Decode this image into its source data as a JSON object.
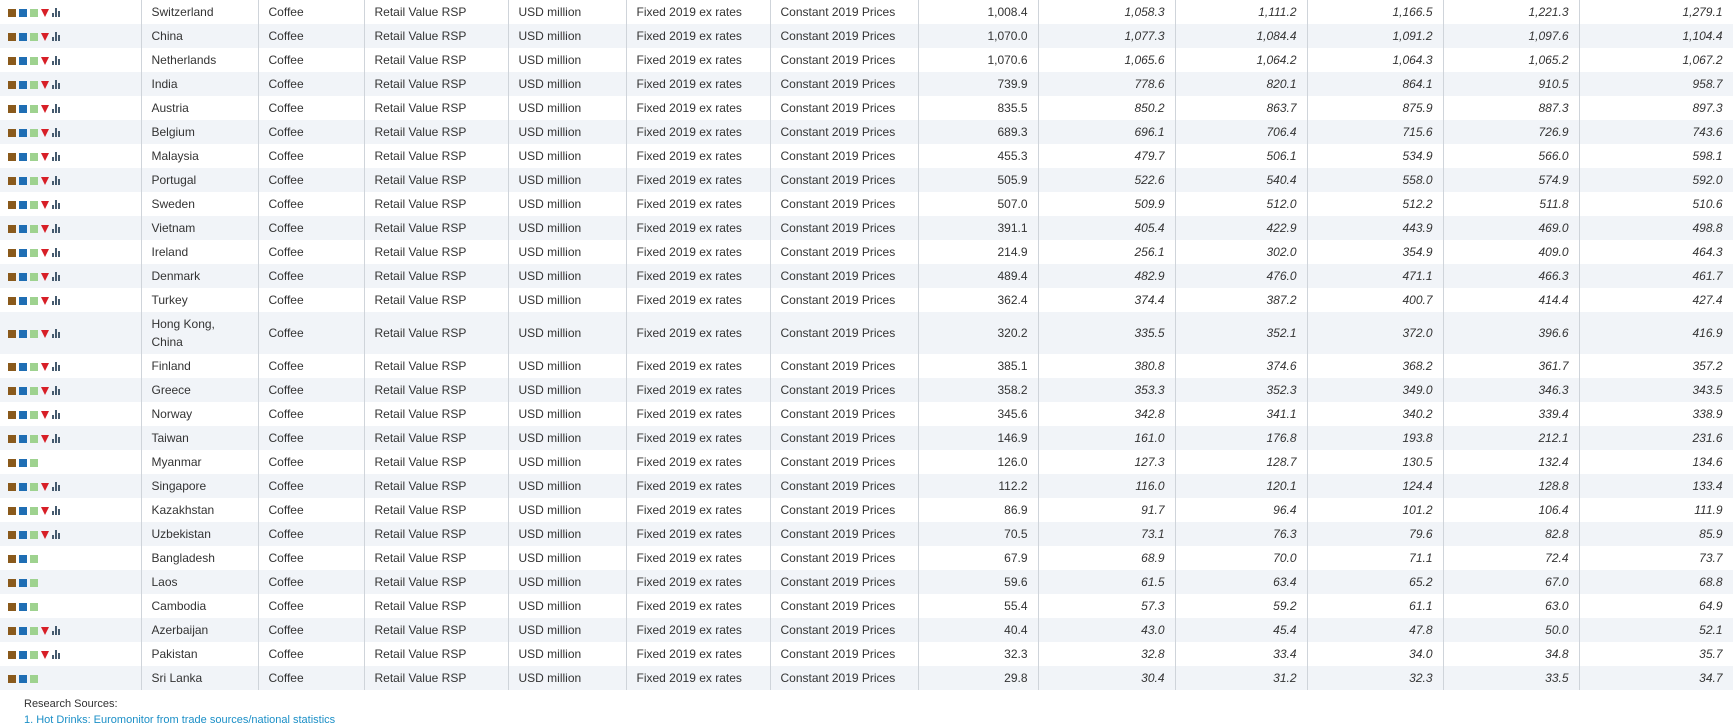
{
  "table": {
    "rows": [
      {
        "geography": "Switzerland",
        "category": "Coffee",
        "data_type": "Retail Value RSP",
        "unit": "USD million",
        "currency": "Fixed 2019 ex rates",
        "price_basis": "Constant 2019 Prices",
        "v2019": "1,008.4",
        "v2020": "1,058.3",
        "v2021": "1,111.2",
        "v2022": "1,166.5",
        "v2023": "1,221.3",
        "v2024": "1,279.1",
        "icons": "full"
      },
      {
        "geography": "China",
        "category": "Coffee",
        "data_type": "Retail Value RSP",
        "unit": "USD million",
        "currency": "Fixed 2019 ex rates",
        "price_basis": "Constant 2019 Prices",
        "v2019": "1,070.0",
        "v2020": "1,077.3",
        "v2021": "1,084.4",
        "v2022": "1,091.2",
        "v2023": "1,097.6",
        "v2024": "1,104.4",
        "icons": "full"
      },
      {
        "geography": "Netherlands",
        "category": "Coffee",
        "data_type": "Retail Value RSP",
        "unit": "USD million",
        "currency": "Fixed 2019 ex rates",
        "price_basis": "Constant 2019 Prices",
        "v2019": "1,070.6",
        "v2020": "1,065.6",
        "v2021": "1,064.2",
        "v2022": "1,064.3",
        "v2023": "1,065.2",
        "v2024": "1,067.2",
        "icons": "full"
      },
      {
        "geography": "India",
        "category": "Coffee",
        "data_type": "Retail Value RSP",
        "unit": "USD million",
        "currency": "Fixed 2019 ex rates",
        "price_basis": "Constant 2019 Prices",
        "v2019": "739.9",
        "v2020": "778.6",
        "v2021": "820.1",
        "v2022": "864.1",
        "v2023": "910.5",
        "v2024": "958.7",
        "icons": "full"
      },
      {
        "geography": "Austria",
        "category": "Coffee",
        "data_type": "Retail Value RSP",
        "unit": "USD million",
        "currency": "Fixed 2019 ex rates",
        "price_basis": "Constant 2019 Prices",
        "v2019": "835.5",
        "v2020": "850.2",
        "v2021": "863.7",
        "v2022": "875.9",
        "v2023": "887.3",
        "v2024": "897.3",
        "icons": "full"
      },
      {
        "geography": "Belgium",
        "category": "Coffee",
        "data_type": "Retail Value RSP",
        "unit": "USD million",
        "currency": "Fixed 2019 ex rates",
        "price_basis": "Constant 2019 Prices",
        "v2019": "689.3",
        "v2020": "696.1",
        "v2021": "706.4",
        "v2022": "715.6",
        "v2023": "726.9",
        "v2024": "743.6",
        "icons": "full"
      },
      {
        "geography": "Malaysia",
        "category": "Coffee",
        "data_type": "Retail Value RSP",
        "unit": "USD million",
        "currency": "Fixed 2019 ex rates",
        "price_basis": "Constant 2019 Prices",
        "v2019": "455.3",
        "v2020": "479.7",
        "v2021": "506.1",
        "v2022": "534.9",
        "v2023": "566.0",
        "v2024": "598.1",
        "icons": "full"
      },
      {
        "geography": "Portugal",
        "category": "Coffee",
        "data_type": "Retail Value RSP",
        "unit": "USD million",
        "currency": "Fixed 2019 ex rates",
        "price_basis": "Constant 2019 Prices",
        "v2019": "505.9",
        "v2020": "522.6",
        "v2021": "540.4",
        "v2022": "558.0",
        "v2023": "574.9",
        "v2024": "592.0",
        "icons": "full"
      },
      {
        "geography": "Sweden",
        "category": "Coffee",
        "data_type": "Retail Value RSP",
        "unit": "USD million",
        "currency": "Fixed 2019 ex rates",
        "price_basis": "Constant 2019 Prices",
        "v2019": "507.0",
        "v2020": "509.9",
        "v2021": "512.0",
        "v2022": "512.2",
        "v2023": "511.8",
        "v2024": "510.6",
        "icons": "full"
      },
      {
        "geography": "Vietnam",
        "category": "Coffee",
        "data_type": "Retail Value RSP",
        "unit": "USD million",
        "currency": "Fixed 2019 ex rates",
        "price_basis": "Constant 2019 Prices",
        "v2019": "391.1",
        "v2020": "405.4",
        "v2021": "422.9",
        "v2022": "443.9",
        "v2023": "469.0",
        "v2024": "498.8",
        "icons": "full"
      },
      {
        "geography": "Ireland",
        "category": "Coffee",
        "data_type": "Retail Value RSP",
        "unit": "USD million",
        "currency": "Fixed 2019 ex rates",
        "price_basis": "Constant 2019 Prices",
        "v2019": "214.9",
        "v2020": "256.1",
        "v2021": "302.0",
        "v2022": "354.9",
        "v2023": "409.0",
        "v2024": "464.3",
        "icons": "full"
      },
      {
        "geography": "Denmark",
        "category": "Coffee",
        "data_type": "Retail Value RSP",
        "unit": "USD million",
        "currency": "Fixed 2019 ex rates",
        "price_basis": "Constant 2019 Prices",
        "v2019": "489.4",
        "v2020": "482.9",
        "v2021": "476.0",
        "v2022": "471.1",
        "v2023": "466.3",
        "v2024": "461.7",
        "icons": "full"
      },
      {
        "geography": "Turkey",
        "category": "Coffee",
        "data_type": "Retail Value RSP",
        "unit": "USD million",
        "currency": "Fixed 2019 ex rates",
        "price_basis": "Constant 2019 Prices",
        "v2019": "362.4",
        "v2020": "374.4",
        "v2021": "387.2",
        "v2022": "400.7",
        "v2023": "414.4",
        "v2024": "427.4",
        "icons": "full"
      },
      {
        "geography": "Hong Kong, China",
        "category": "Coffee",
        "data_type": "Retail Value RSP",
        "unit": "USD million",
        "currency": "Fixed 2019 ex rates",
        "price_basis": "Constant 2019 Prices",
        "v2019": "320.2",
        "v2020": "335.5",
        "v2021": "352.1",
        "v2022": "372.0",
        "v2023": "396.6",
        "v2024": "416.9",
        "icons": "full",
        "tall": true
      },
      {
        "geography": "Finland",
        "category": "Coffee",
        "data_type": "Retail Value RSP",
        "unit": "USD million",
        "currency": "Fixed 2019 ex rates",
        "price_basis": "Constant 2019 Prices",
        "v2019": "385.1",
        "v2020": "380.8",
        "v2021": "374.6",
        "v2022": "368.2",
        "v2023": "361.7",
        "v2024": "357.2",
        "icons": "full"
      },
      {
        "geography": "Greece",
        "category": "Coffee",
        "data_type": "Retail Value RSP",
        "unit": "USD million",
        "currency": "Fixed 2019 ex rates",
        "price_basis": "Constant 2019 Prices",
        "v2019": "358.2",
        "v2020": "353.3",
        "v2021": "352.3",
        "v2022": "349.0",
        "v2023": "346.3",
        "v2024": "343.5",
        "icons": "full"
      },
      {
        "geography": "Norway",
        "category": "Coffee",
        "data_type": "Retail Value RSP",
        "unit": "USD million",
        "currency": "Fixed 2019 ex rates",
        "price_basis": "Constant 2019 Prices",
        "v2019": "345.6",
        "v2020": "342.8",
        "v2021": "341.1",
        "v2022": "340.2",
        "v2023": "339.4",
        "v2024": "338.9",
        "icons": "full"
      },
      {
        "geography": "Taiwan",
        "category": "Coffee",
        "data_type": "Retail Value RSP",
        "unit": "USD million",
        "currency": "Fixed 2019 ex rates",
        "price_basis": "Constant 2019 Prices",
        "v2019": "146.9",
        "v2020": "161.0",
        "v2021": "176.8",
        "v2022": "193.8",
        "v2023": "212.1",
        "v2024": "231.6",
        "icons": "full"
      },
      {
        "geography": "Myanmar",
        "category": "Coffee",
        "data_type": "Retail Value RSP",
        "unit": "USD million",
        "currency": "Fixed 2019 ex rates",
        "price_basis": "Constant 2019 Prices",
        "v2019": "126.0",
        "v2020": "127.3",
        "v2021": "128.7",
        "v2022": "130.5",
        "v2023": "132.4",
        "v2024": "134.6",
        "icons": "short"
      },
      {
        "geography": "Singapore",
        "category": "Coffee",
        "data_type": "Retail Value RSP",
        "unit": "USD million",
        "currency": "Fixed 2019 ex rates",
        "price_basis": "Constant 2019 Prices",
        "v2019": "112.2",
        "v2020": "116.0",
        "v2021": "120.1",
        "v2022": "124.4",
        "v2023": "128.8",
        "v2024": "133.4",
        "icons": "full"
      },
      {
        "geography": "Kazakhstan",
        "category": "Coffee",
        "data_type": "Retail Value RSP",
        "unit": "USD million",
        "currency": "Fixed 2019 ex rates",
        "price_basis": "Constant 2019 Prices",
        "v2019": "86.9",
        "v2020": "91.7",
        "v2021": "96.4",
        "v2022": "101.2",
        "v2023": "106.4",
        "v2024": "111.9",
        "icons": "full"
      },
      {
        "geography": "Uzbekistan",
        "category": "Coffee",
        "data_type": "Retail Value RSP",
        "unit": "USD million",
        "currency": "Fixed 2019 ex rates",
        "price_basis": "Constant 2019 Prices",
        "v2019": "70.5",
        "v2020": "73.1",
        "v2021": "76.3",
        "v2022": "79.6",
        "v2023": "82.8",
        "v2024": "85.9",
        "icons": "full"
      },
      {
        "geography": "Bangladesh",
        "category": "Coffee",
        "data_type": "Retail Value RSP",
        "unit": "USD million",
        "currency": "Fixed 2019 ex rates",
        "price_basis": "Constant 2019 Prices",
        "v2019": "67.9",
        "v2020": "68.9",
        "v2021": "70.0",
        "v2022": "71.1",
        "v2023": "72.4",
        "v2024": "73.7",
        "icons": "short"
      },
      {
        "geography": "Laos",
        "category": "Coffee",
        "data_type": "Retail Value RSP",
        "unit": "USD million",
        "currency": "Fixed 2019 ex rates",
        "price_basis": "Constant 2019 Prices",
        "v2019": "59.6",
        "v2020": "61.5",
        "v2021": "63.4",
        "v2022": "65.2",
        "v2023": "67.0",
        "v2024": "68.8",
        "icons": "short"
      },
      {
        "geography": "Cambodia",
        "category": "Coffee",
        "data_type": "Retail Value RSP",
        "unit": "USD million",
        "currency": "Fixed 2019 ex rates",
        "price_basis": "Constant 2019 Prices",
        "v2019": "55.4",
        "v2020": "57.3",
        "v2021": "59.2",
        "v2022": "61.1",
        "v2023": "63.0",
        "v2024": "64.9",
        "icons": "short"
      },
      {
        "geography": "Azerbaijan",
        "category": "Coffee",
        "data_type": "Retail Value RSP",
        "unit": "USD million",
        "currency": "Fixed 2019 ex rates",
        "price_basis": "Constant 2019 Prices",
        "v2019": "40.4",
        "v2020": "43.0",
        "v2021": "45.4",
        "v2022": "47.8",
        "v2023": "50.0",
        "v2024": "52.1",
        "icons": "full"
      },
      {
        "geography": "Pakistan",
        "category": "Coffee",
        "data_type": "Retail Value RSP",
        "unit": "USD million",
        "currency": "Fixed 2019 ex rates",
        "price_basis": "Constant 2019 Prices",
        "v2019": "32.3",
        "v2020": "32.8",
        "v2021": "33.4",
        "v2022": "34.0",
        "v2023": "34.8",
        "v2024": "35.7",
        "icons": "full"
      },
      {
        "geography": "Sri Lanka",
        "category": "Coffee",
        "data_type": "Retail Value RSP",
        "unit": "USD million",
        "currency": "Fixed 2019 ex rates",
        "price_basis": "Constant 2019 Prices",
        "v2019": "29.8",
        "v2020": "30.4",
        "v2021": "31.2",
        "v2022": "32.3",
        "v2023": "33.5",
        "v2024": "34.7",
        "icons": "short"
      }
    ]
  },
  "footer": {
    "sources_label": "Research Sources:",
    "source_link": "1. Hot Drinks: Euromonitor from trade sources/national statistics"
  },
  "colors": {
    "row_alt": "#f1f4f8",
    "link": "#1b8fc7",
    "icon_brown": "#8a5a1c",
    "icon_blue": "#1f6eb4",
    "icon_green": "#9ed28f",
    "icon_red": "#d71f27"
  },
  "icon_names": [
    "geography-icon",
    "category-icon",
    "industry-icon",
    "filter-icon",
    "chart-icon"
  ]
}
